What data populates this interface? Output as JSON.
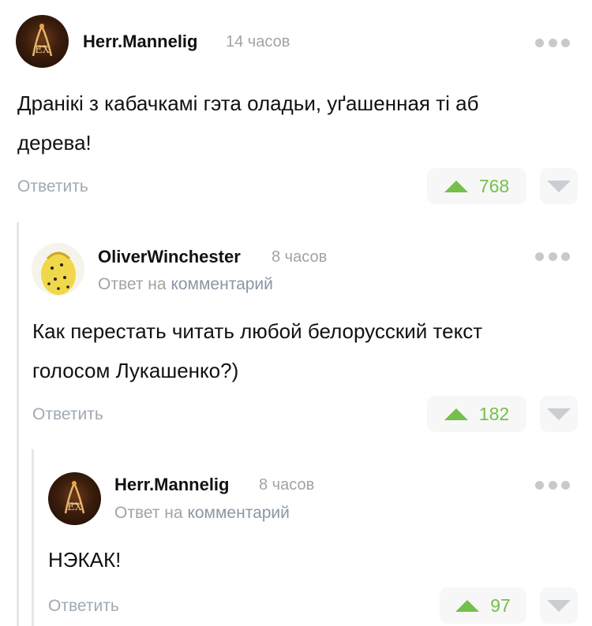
{
  "comments": [
    {
      "author": "Herr.Mannelig",
      "time": "14 часов",
      "text_lines": [
        "Дранікі з кабачкамі гэта оладьи, уґашенная ті аб",
        "дерева!"
      ],
      "reply_label": "Ответить",
      "votes": "768"
    },
    {
      "author": "OliverWinchester",
      "time": "8 часов",
      "reply_to_prefix": "Ответ на",
      "reply_to_link": "комментарий",
      "text_lines": [
        "Как перестать читать любой белорусский текст",
        "голосом Лукашенко?)"
      ],
      "reply_label": "Ответить",
      "votes": "182"
    },
    {
      "author": "Herr.Mannelig",
      "time": "8 часов",
      "reply_to_prefix": "Ответ на",
      "reply_to_link": "комментарий",
      "text_lines": [
        "НЭКАК!"
      ],
      "reply_label": "Ответить",
      "votes": "97"
    }
  ],
  "colors": {
    "upvote": "#74c04a",
    "muted": "#a3a3a3",
    "link": "#8a97a6"
  }
}
